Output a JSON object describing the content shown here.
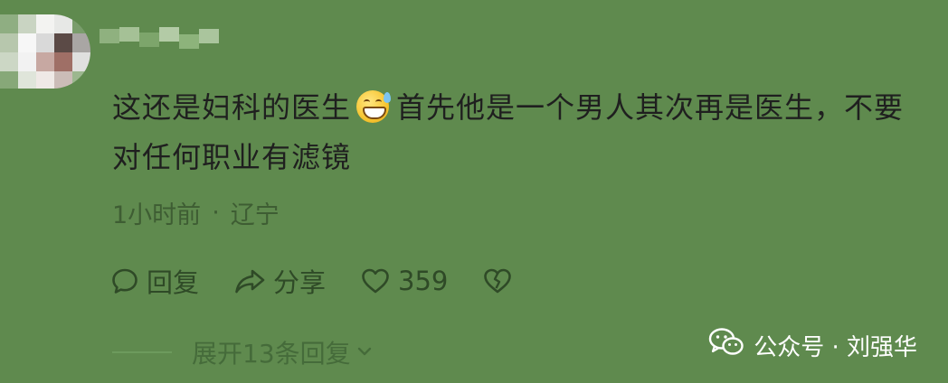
{
  "comment": {
    "text_before_emoji": "这还是妇科的医生",
    "emoji_icon": "grinning-sweat-emoji",
    "text_after_emoji": "首先他是一个男人其次再是医生，不要对任何职业有滤镜",
    "time": "1小时前",
    "separator": "·",
    "location": "辽宁"
  },
  "actions": {
    "reply_label": "回复",
    "share_label": "分享",
    "like_count": "359"
  },
  "replies": {
    "expand_label": "展开13条回复"
  },
  "watermark": {
    "text": "公众号 · 刘强华"
  },
  "colors": {
    "background": "#5f8a4e",
    "text": "#1f1f1f",
    "meta": "#3e5d33"
  }
}
